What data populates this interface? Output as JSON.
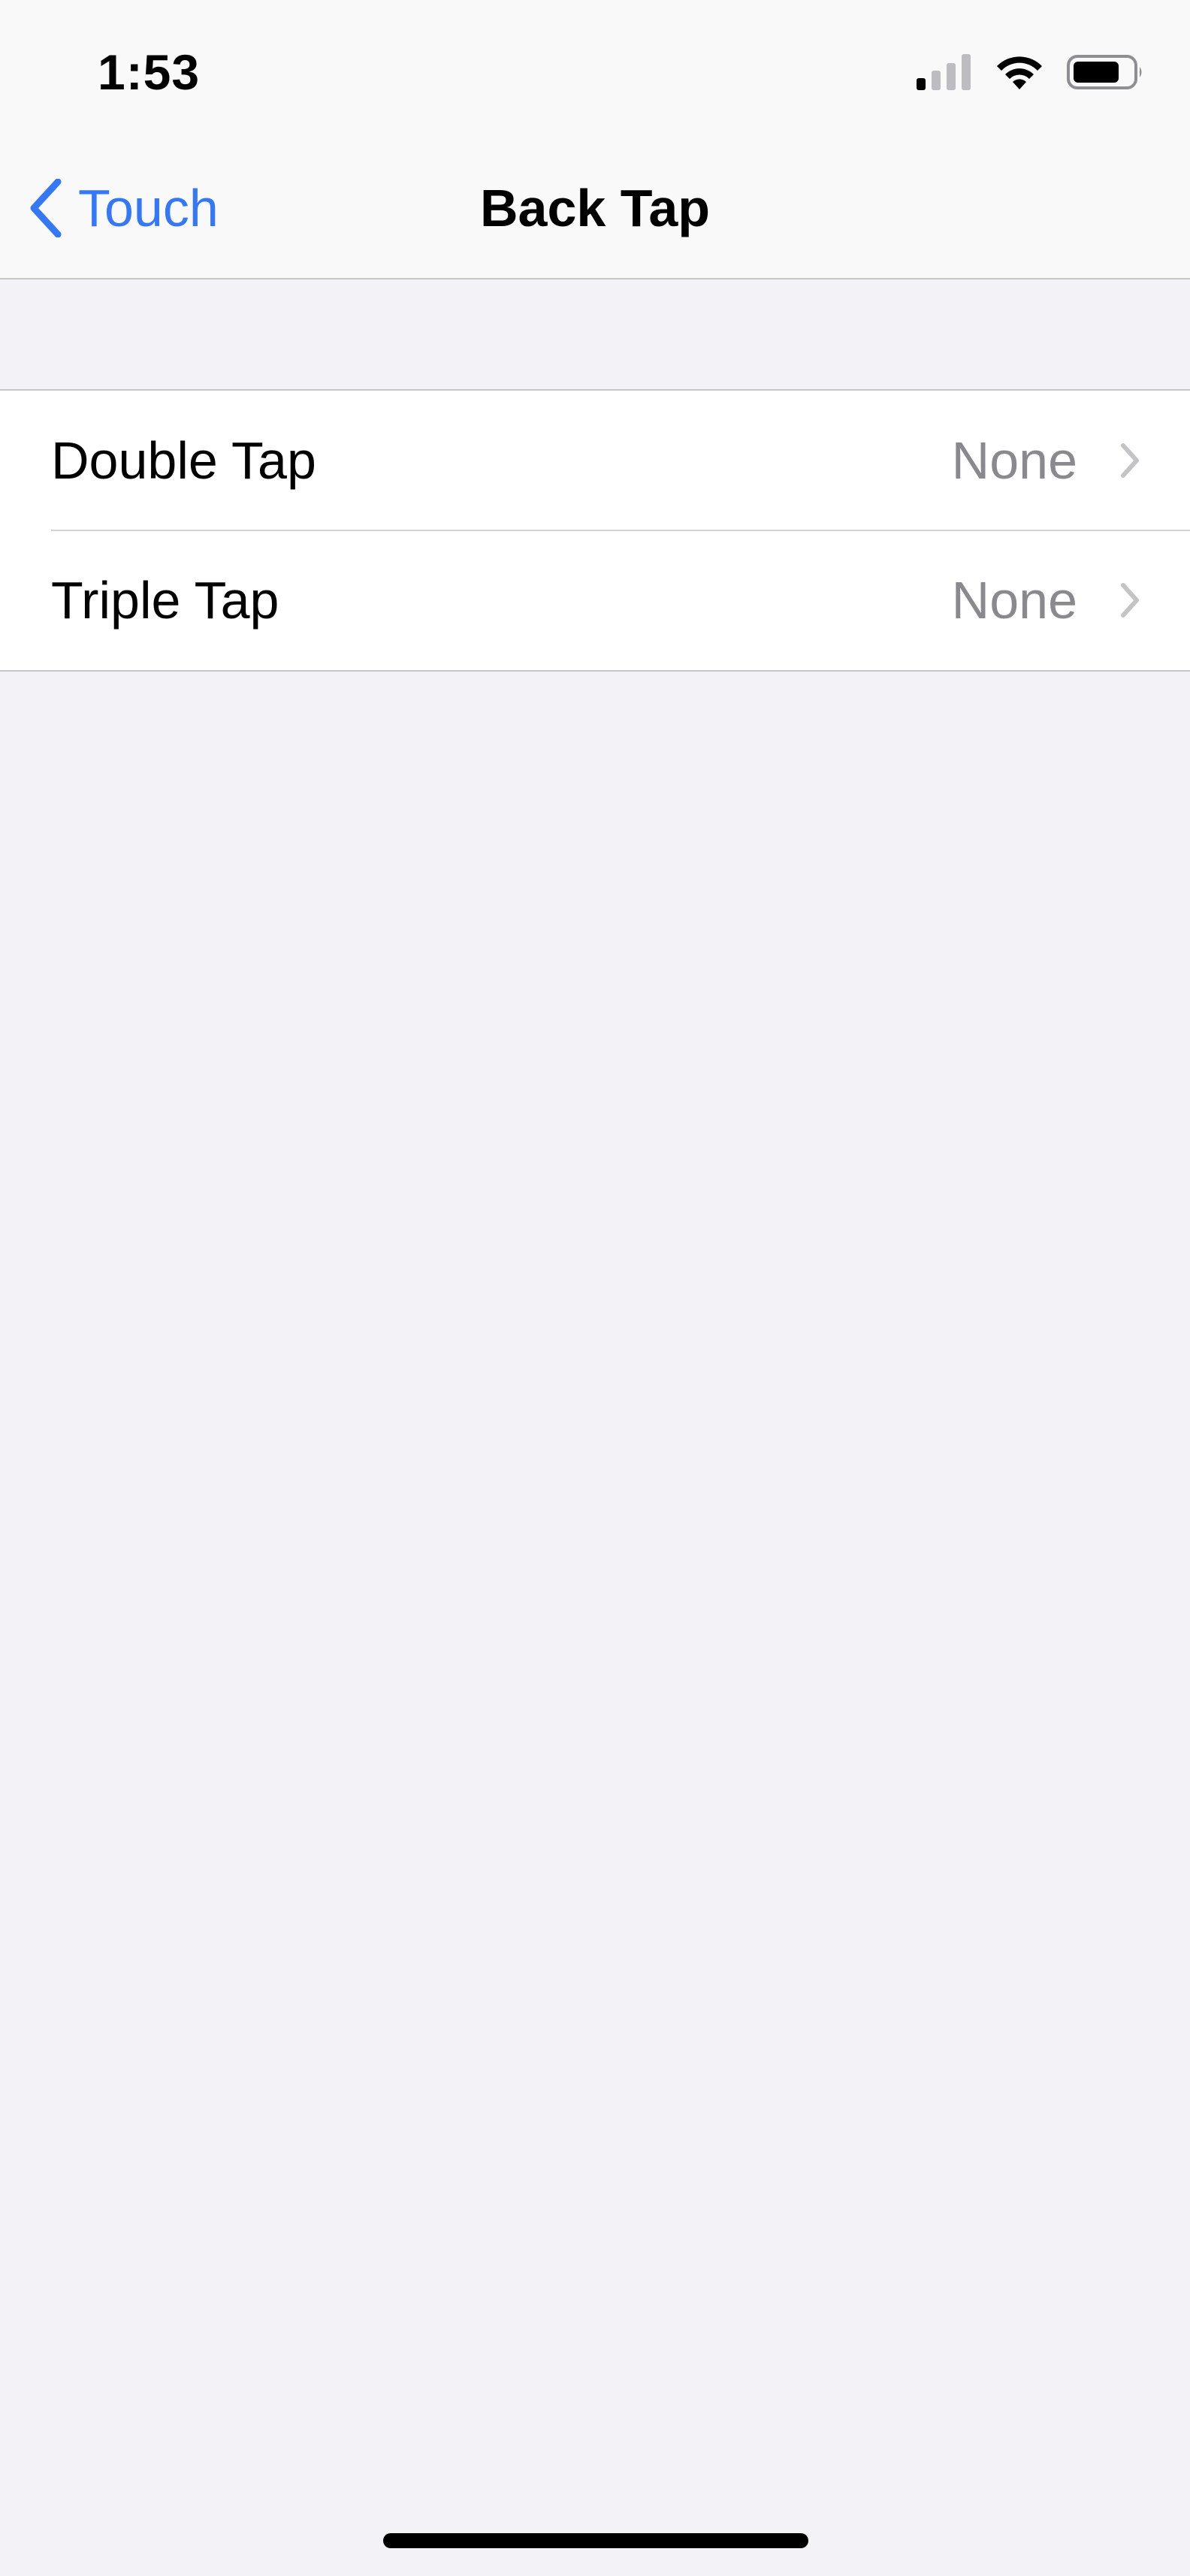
{
  "status_bar": {
    "time": "1:53"
  },
  "nav": {
    "back_label": "Touch",
    "title": "Back Tap"
  },
  "rows": [
    {
      "label": "Double Tap",
      "value": "None"
    },
    {
      "label": "Triple Tap",
      "value": "None"
    }
  ],
  "colors": {
    "accent": "#3478f6",
    "background": "#f2f2f7",
    "secondary_text": "#8a8a8e"
  },
  "icons": {
    "signal": "cellular-signal-icon",
    "wifi": "wifi-icon",
    "battery": "battery-icon",
    "back": "chevron-left-icon",
    "disclosure": "chevron-right-icon"
  }
}
